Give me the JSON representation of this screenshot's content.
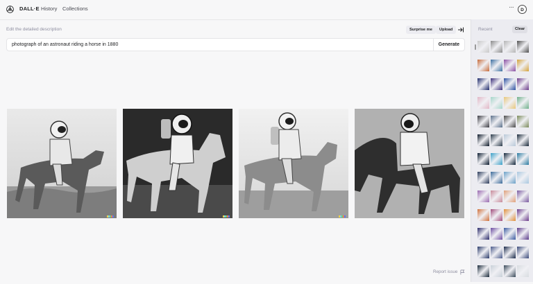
{
  "app": {
    "brand": "DALL·E",
    "nav": [
      "History",
      "Collections"
    ],
    "more": "···",
    "avatar_initial": "D"
  },
  "prompt": {
    "label": "Edit the detailed description",
    "surprise": "Surprise me",
    "upload": "Upload",
    "value": "photograph of an astronaut riding a horse in 1880",
    "generate": "Generate"
  },
  "results": [
    {
      "name": "result-image-1",
      "alt": "astronaut on horse"
    },
    {
      "name": "result-image-2",
      "alt": "astronaut on horse"
    },
    {
      "name": "result-image-3",
      "alt": "astronaut on horse"
    },
    {
      "name": "result-image-4",
      "alt": "astronaut on horse"
    }
  ],
  "footer": {
    "report": "Report issue"
  },
  "sidebar": {
    "title": "Recent",
    "clear": "Clear",
    "rows": [
      [
        "#c9c9c9",
        "#8a8a8a",
        "#b5b5b5",
        "#4f4f4f"
      ],
      [
        "#c76b3a",
        "#3b6fa0",
        "#8a4fa3",
        "#d4a23b"
      ],
      [
        "#1e2a6b",
        "#3a2d7a",
        "#2a4fa0",
        "#6a3a8a"
      ],
      [
        "#e2b7c6",
        "#a5d6c9",
        "#e8c77a",
        "#6fb08a"
      ],
      [
        "#3c3c44",
        "#5a6f8a",
        "#4a4a4a",
        "#7a8a5a"
      ],
      [
        "#0e1a2a",
        "#2a3a4a",
        "#b8c8d8",
        "#1a2a3a"
      ],
      [
        "#0a1a2e",
        "#3aa0c8",
        "#14283c",
        "#2a7aa0"
      ],
      [
        "#2a3a5a",
        "#3a6a9a",
        "#6aa0c8",
        "#aac8e0"
      ],
      [
        "#9a6ab0",
        "#c88a9a",
        "#e0a07a",
        "#7a5aa0"
      ],
      [
        "#d0703a",
        "#a04a7a",
        "#e0903a",
        "#6a3a8a"
      ],
      [
        "#2a2a6a",
        "#6a4aa0",
        "#3a5aa0",
        "#5a3a8a"
      ],
      [
        "#2a3a6a",
        "#4a5a8a",
        "#1a2a4a",
        "#3a4a7a"
      ],
      [
        "#1a2a3a",
        "#c8d0d8",
        "#3a4a5a",
        "#d8dce0"
      ]
    ]
  },
  "colors": {
    "accent": "#202123",
    "muted": "#8e8ea0",
    "surface": "#f7f7f8",
    "sidebar": "#ececf1"
  }
}
